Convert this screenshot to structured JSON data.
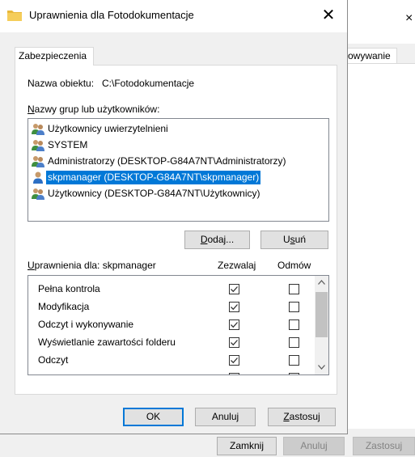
{
  "dialog": {
    "title": "Uprawnienia dla Fotodokumentacje",
    "tab": "Zabezpieczenia",
    "object_label": "Nazwa obiektu:",
    "object_value": "C:\\Fotodokumentacje",
    "users_heading_accel": "N",
    "users_heading_rest": "azwy grup lub użytkowników:",
    "users": [
      {
        "label": "Użytkownicy uwierzytelnieni",
        "icon": "group-icon"
      },
      {
        "label": "SYSTEM",
        "icon": "group-icon"
      },
      {
        "label": "Administratorzy (DESKTOP-G84A7NT\\Administratorzy)",
        "icon": "group-icon"
      },
      {
        "label": "skpmanager (DESKTOP-G84A7NT\\skpmanager)",
        "icon": "user-icon",
        "selected": true
      },
      {
        "label": "Użytkownicy (DESKTOP-G84A7NT\\Użytkownicy)",
        "icon": "group-icon"
      }
    ],
    "add_button_accel": "D",
    "add_button_rest": "odaj...",
    "remove_button_pre": "U",
    "remove_button_accel": "s",
    "remove_button_post": "uń",
    "perm_for_accel": "U",
    "perm_for_rest": "prawnienia dla: skpmanager",
    "col_allow": "Zezwalaj",
    "col_deny": "Odmów",
    "permissions": [
      {
        "name": "Pełna kontrola",
        "allow": true,
        "deny": false
      },
      {
        "name": "Modyfikacja",
        "allow": true,
        "deny": false
      },
      {
        "name": "Odczyt i wykonywanie",
        "allow": true,
        "deny": false
      },
      {
        "name": "Wyświetlanie zawartości folderu",
        "allow": true,
        "deny": false
      },
      {
        "name": "Odczyt",
        "allow": true,
        "deny": false
      }
    ],
    "ok_button": "OK",
    "cancel_button": "Anuluj",
    "apply_button_accel": "Z",
    "apply_button_rest": "astosuj"
  },
  "background_window": {
    "close_glyph": "×",
    "tab_fragment": "ywanie",
    "close_button": "Zamknij",
    "cancel_button": "Anuluj",
    "apply_button": "Zastosuj"
  },
  "colors": {
    "selection": "#0078d7",
    "default_button_border": "#0078d7",
    "folder_icon": "#e8b83a"
  }
}
